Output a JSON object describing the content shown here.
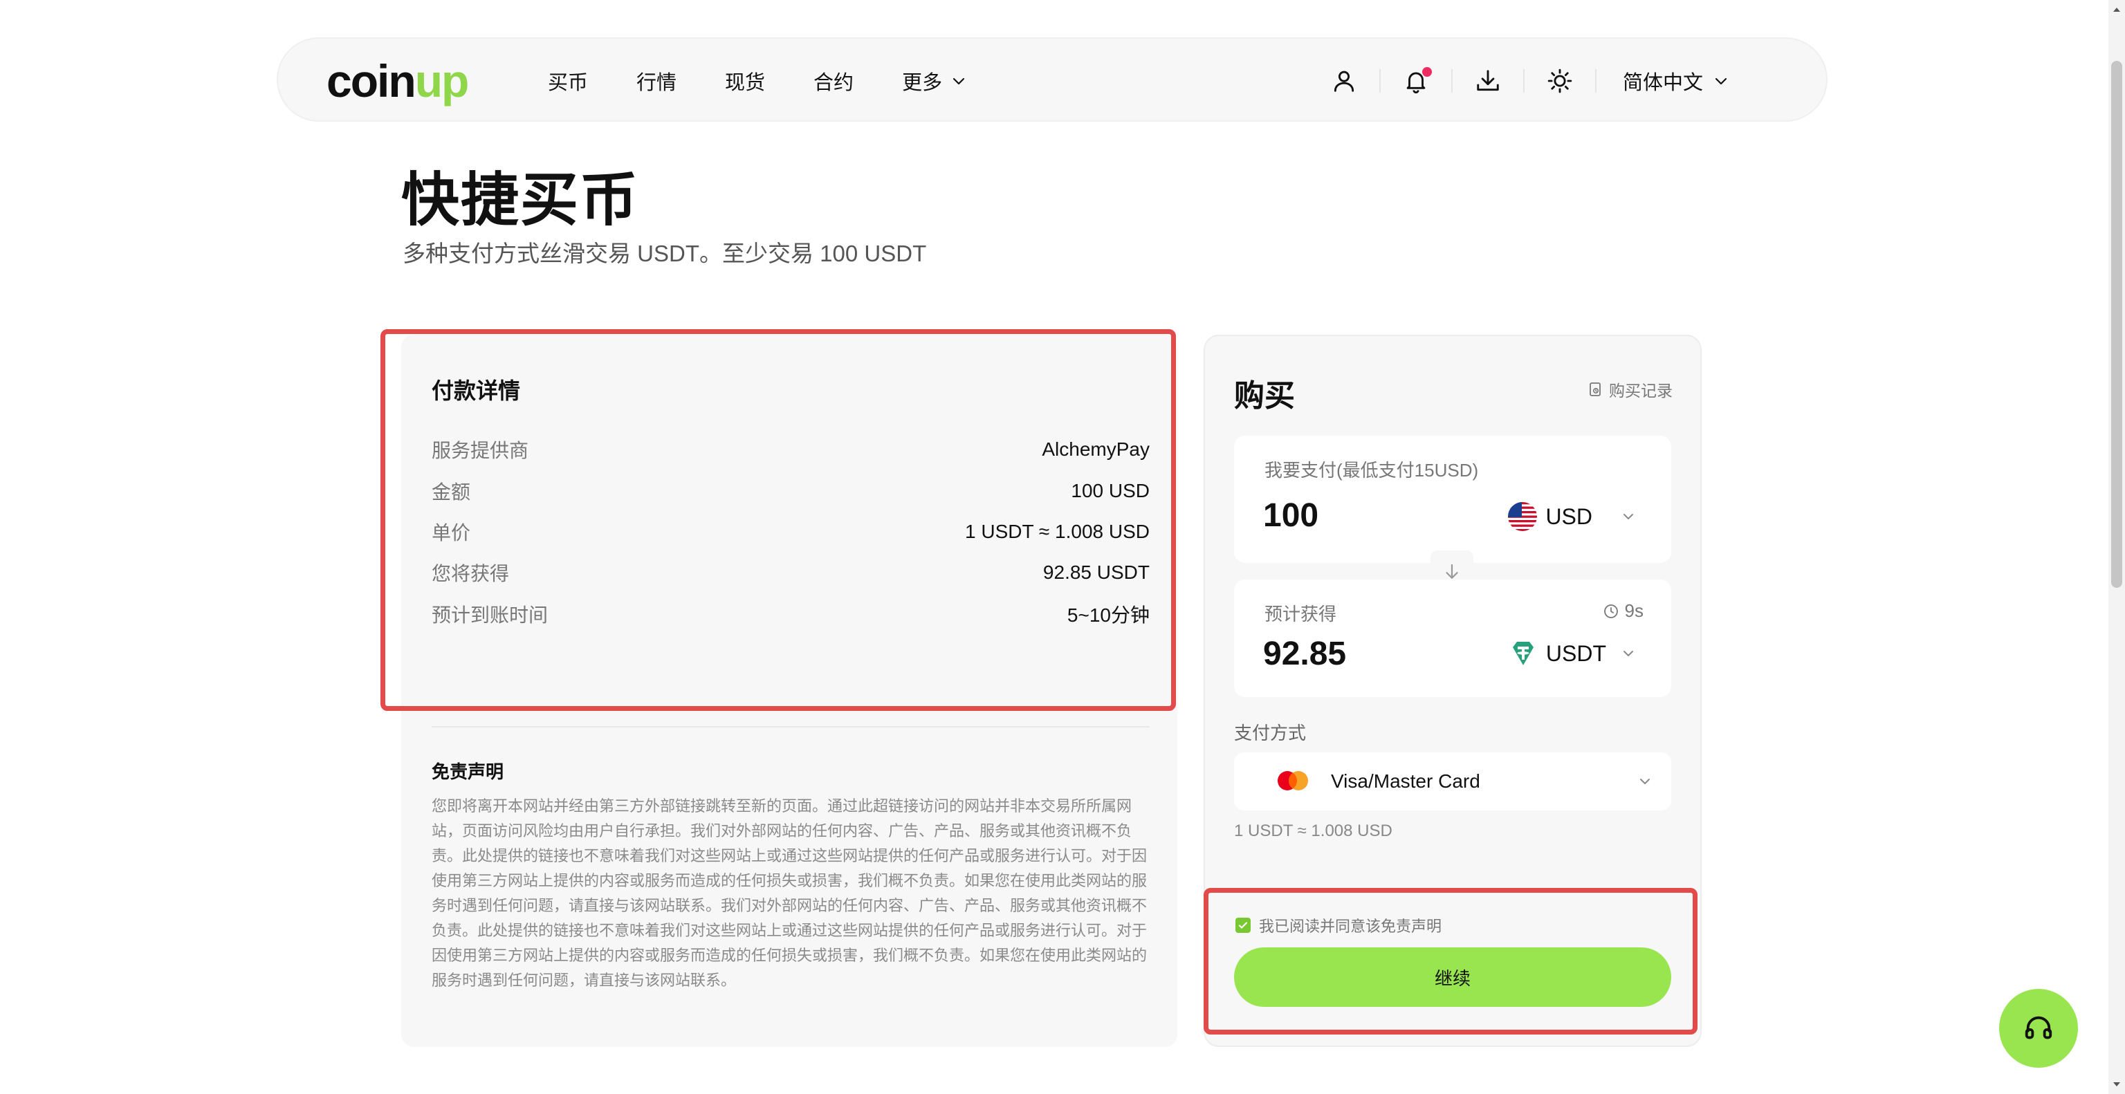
{
  "nav": {
    "logo_main": "coin",
    "logo_accent": "up",
    "links": [
      {
        "label": "买币"
      },
      {
        "label": "行情"
      },
      {
        "label": "现货"
      },
      {
        "label": "合约"
      },
      {
        "label": "更多"
      }
    ],
    "icons": [
      "user-icon",
      "bell-icon",
      "download-icon",
      "sun-icon"
    ],
    "language": "简体中文"
  },
  "header": {
    "title": "快捷买币",
    "subtitle": "多种支付方式丝滑交易 USDT。至少交易 100 USDT"
  },
  "payment_details": {
    "title": "付款详情",
    "rows": [
      {
        "label": "服务提供商",
        "value": "AlchemyPay"
      },
      {
        "label": "金额",
        "value": "100 USD"
      },
      {
        "label": "单价",
        "value": "1 USDT ≈ 1.008 USD"
      },
      {
        "label": "您将获得",
        "value": "92.85 USDT"
      },
      {
        "label": "预计到账时间",
        "value": "5~10分钟"
      }
    ]
  },
  "disclaimer": {
    "title": "免责声明",
    "text": "您即将离开本网站并经由第三方外部链接跳转至新的页面。通过此超链接访问的网站并非本交易所所属网站，页面访问风险均由用户自行承担。我们对外部网站的任何内容、广告、产品、服务或其他资讯概不负责。此处提供的链接也不意味着我们对这些网站上或通过这些网站提供的任何产品或服务进行认可。对于因使用第三方网站上提供的内容或服务而造成的任何损失或损害，我们概不负责。如果您在使用此类网站的服务时遇到任何问题，请直接与该网站联系。我们对外部网站的任何内容、广告、产品、服务或其他资讯概不负责。此处提供的链接也不意味着我们对这些网站上或通过这些网站提供的任何产品或服务进行认可。对于因使用第三方网站上提供的内容或服务而造成的任何损失或损害，我们概不负责。如果您在使用此类网站的服务时遇到任何问题，请直接与该网站联系。"
  },
  "buy": {
    "title": "购买",
    "history_label": "购买记录",
    "pay_label": "我要支付(最低支付15USD)",
    "pay_amount": "100",
    "pay_currency": "USD",
    "get_label": "预计获得",
    "get_amount": "92.85",
    "get_currency": "USDT",
    "timer": "9s",
    "method_label": "支付方式",
    "method_value": "Visa/Master Card",
    "rate": "1 USDT ≈ 1.008 USD",
    "agree_label": "我已阅读并同意该免责声明",
    "agree_checked": true,
    "continue_label": "继续"
  },
  "colors": {
    "accent": "#98e550",
    "highlight": "#e34b4b",
    "notification": "#ee2c5f",
    "tether": "#26a17b"
  }
}
